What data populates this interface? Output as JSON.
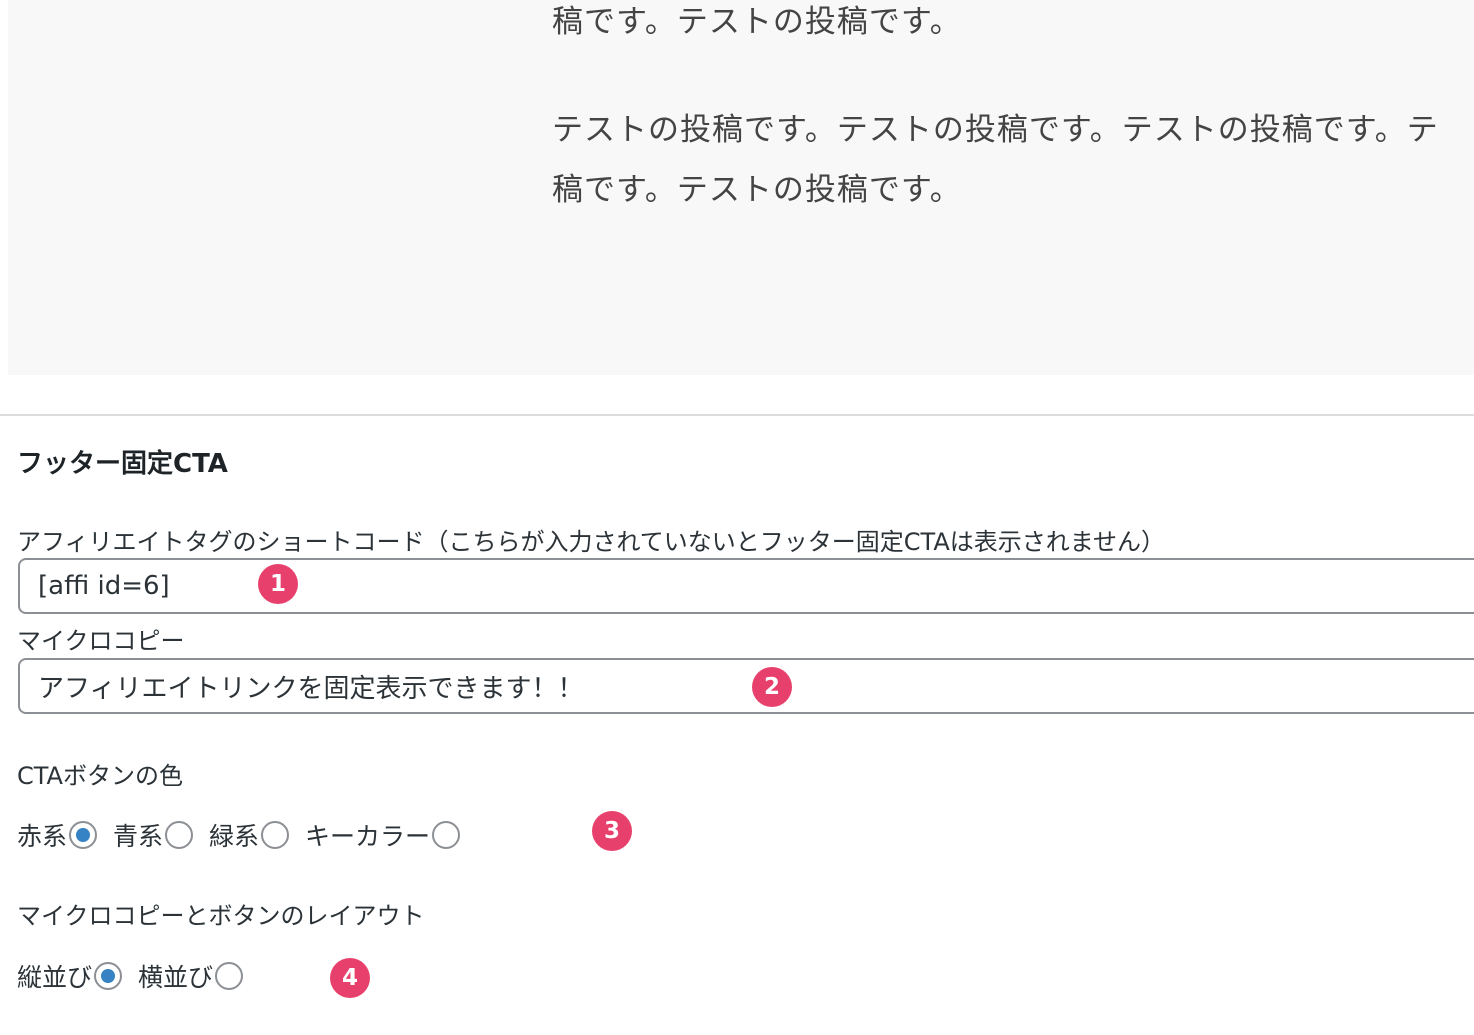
{
  "preview": {
    "lines": [
      "稿です。テストの投稿です。",
      "テストの投稿です。テストの投稿です。テストの投稿です。テ",
      "稿です。テストの投稿です。"
    ]
  },
  "section": {
    "title": "フッター固定CTA"
  },
  "shortcode": {
    "label": "アフィリエイトタグのショートコード（こちらが入力されていないとフッター固定CTAは表示されません）",
    "value": "[affi id=6]"
  },
  "microcopy": {
    "label": "マイクロコピー",
    "value": "アフィリエイトリンクを固定表示できます！！"
  },
  "button_color": {
    "label": "CTAボタンの色",
    "options": [
      {
        "label": "赤系",
        "checked": true
      },
      {
        "label": "青系",
        "checked": false
      },
      {
        "label": "緑系",
        "checked": false
      },
      {
        "label": "キーカラー",
        "checked": false
      }
    ]
  },
  "layout": {
    "label": "マイクロコピーとボタンのレイアウト",
    "options": [
      {
        "label": "縦並び",
        "checked": true
      },
      {
        "label": "横並び",
        "checked": false
      }
    ]
  },
  "badges": [
    "1",
    "2",
    "3",
    "4"
  ],
  "colors": {
    "accent_radio": "#3582c4",
    "badge": "#e8406c",
    "preview_bg": "#f8f8f8"
  }
}
